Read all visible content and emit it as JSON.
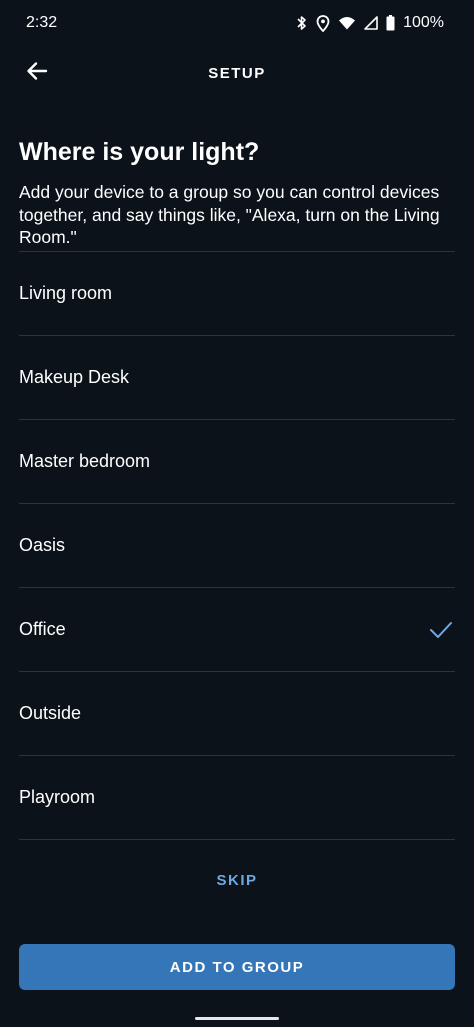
{
  "status_bar": {
    "time": "2:32",
    "battery_percent": "100%",
    "icons": [
      "bluetooth-icon",
      "location-icon",
      "wifi-icon",
      "signal-icon",
      "battery-icon"
    ]
  },
  "header": {
    "title": "SETUP",
    "back_icon": "arrow-left-icon"
  },
  "page": {
    "title": "Where is your light?",
    "description": "Add your device to a group so you can control devices together, and say things like, \"Alexa, turn on the Living Room.\""
  },
  "groups": [
    {
      "label": "Living room",
      "selected": false
    },
    {
      "label": "Makeup Desk",
      "selected": false
    },
    {
      "label": "Master bedroom",
      "selected": false
    },
    {
      "label": "Oasis",
      "selected": false
    },
    {
      "label": "Office",
      "selected": true
    },
    {
      "label": "Outside",
      "selected": false
    },
    {
      "label": "Playroom",
      "selected": false
    }
  ],
  "actions": {
    "skip_label": "SKIP",
    "add_label": "ADD TO GROUP"
  },
  "colors": {
    "background": "#0b121a",
    "accent": "#3476b8",
    "link": "#6fa8e0",
    "divider": "#2a333e"
  }
}
